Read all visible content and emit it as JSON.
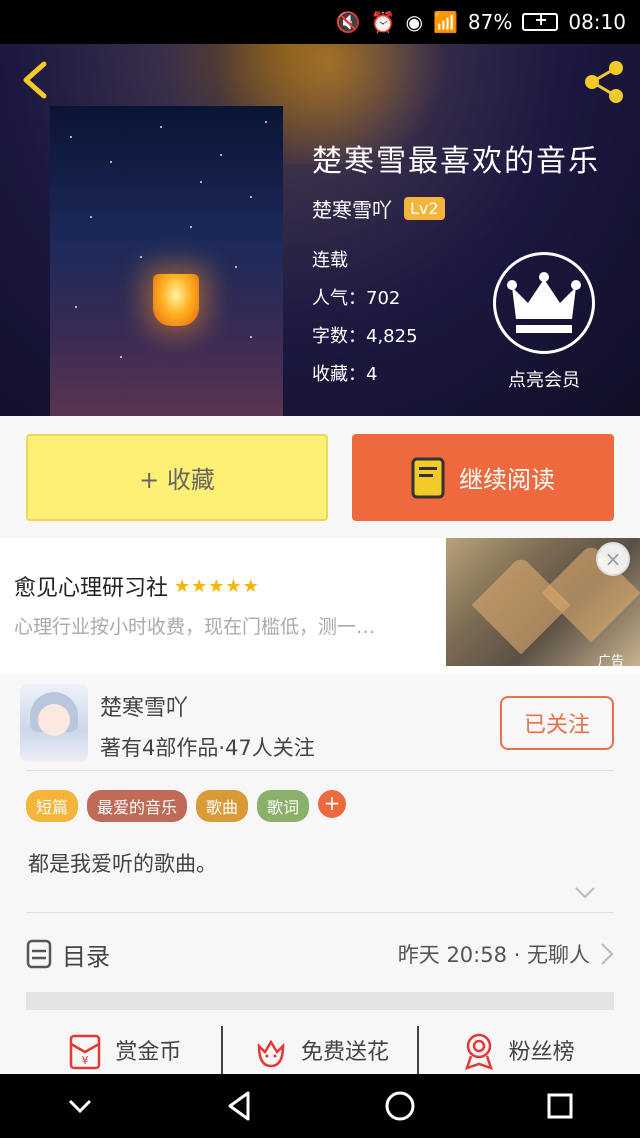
{
  "status_bar": {
    "battery": "87%",
    "time": "08:10"
  },
  "book": {
    "title": "楚寒雪最喜欢的音乐",
    "author": "楚寒雪吖",
    "level": "Lv2",
    "status": "连载",
    "popularity": "人气：702",
    "word_count": "字数：4,825",
    "favorites": "收藏：4"
  },
  "vip": {
    "label": "点亮会员"
  },
  "actions": {
    "collect_label": "+ 收藏",
    "read_label": "继续阅读"
  },
  "ad": {
    "title": "愈见心理研习社",
    "stars": "★★★★★",
    "description": "心理行业按小时收费，现在门槛低，测一…",
    "tag": "广告"
  },
  "author_card": {
    "name": "楚寒雪吖",
    "stats": "著有4部作品·47人关注",
    "follow_label": "已关注",
    "tags": [
      {
        "label": "短篇",
        "color": "#f4b53a"
      },
      {
        "label": "最爱的音乐",
        "color": "#c06a58"
      },
      {
        "label": "歌曲",
        "color": "#d99a38"
      },
      {
        "label": "歌词",
        "color": "#8ab06a"
      }
    ],
    "description": "都是我爱听的歌曲。"
  },
  "toc": {
    "label": "目录",
    "updated": "昨天 20:58 · 无聊人"
  },
  "bottom_actions": {
    "coins": "赏金币",
    "flowers": "免费送花",
    "fans": "粉丝榜"
  },
  "colors": {
    "accent": "#ee6a3e",
    "collect_bg": "#fdf074",
    "follow": "#e8704a"
  }
}
